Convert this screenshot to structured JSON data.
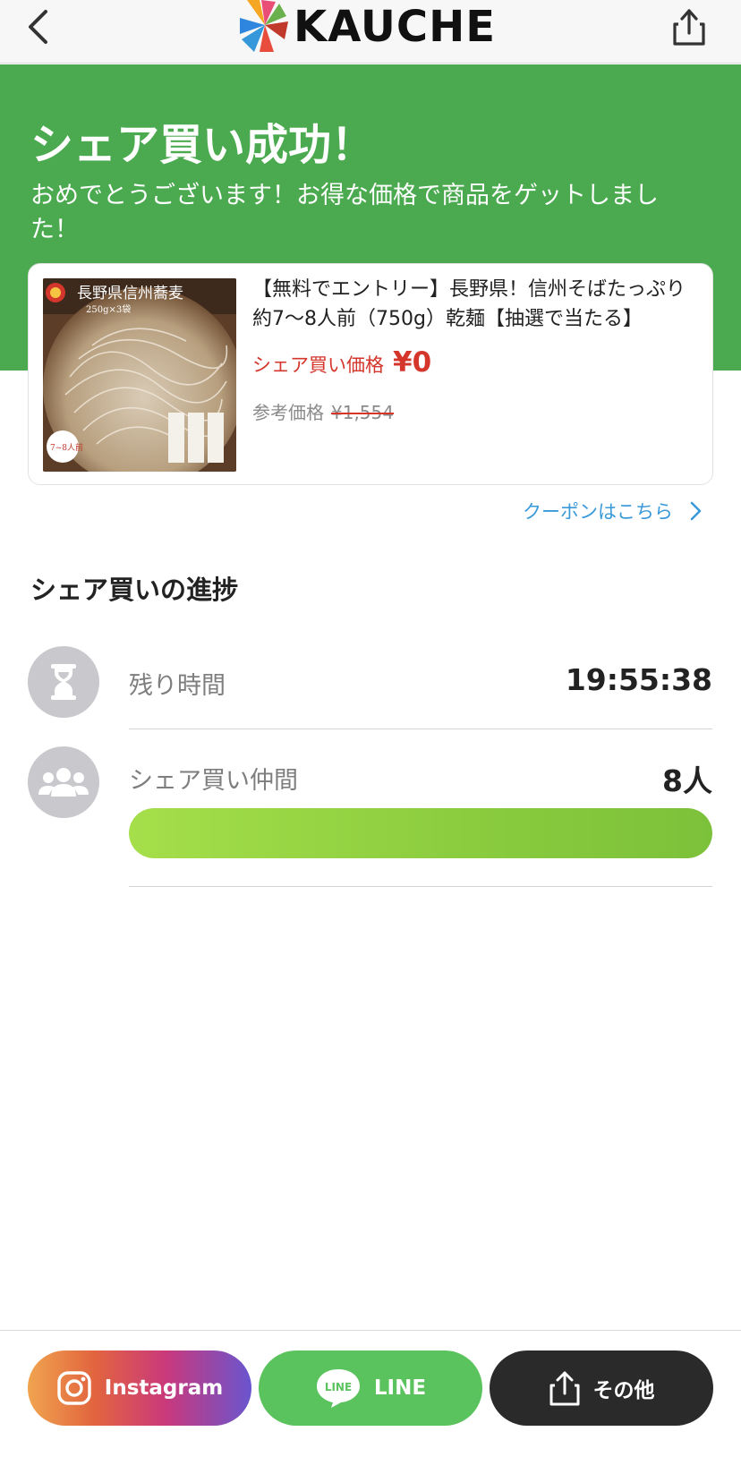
{
  "header": {
    "logo_text": "KAUCHE",
    "back_icon": "chevron-left-icon",
    "share_icon": "share-icon"
  },
  "hero": {
    "title": "シェア買い成功！",
    "subtitle": "おめでとうございます！お得な価格で商品をゲットしました！"
  },
  "product": {
    "title": "【無料でエントリー】長野県！信州そばたっぷり約7〜8人前（750g）乾麺【抽選で当たる】",
    "price_label": "シェア買い価格",
    "price_value": "¥0",
    "ref_label": "参考価格",
    "ref_value": "¥1,554",
    "image_caption": "長野県信州蕎麦",
    "image_sub": "250g×3袋",
    "image_badge": "7~8人前"
  },
  "coupon": {
    "label": "クーポンはこちら"
  },
  "progress": {
    "section_title": "シェア買いの進捗",
    "time_label": "残り時間",
    "time_value": "19:55:38",
    "members_label": "シェア買い仲間",
    "members_value": "8人",
    "progress_fraction": 1.0
  },
  "share_bar": {
    "instagram_label": "Instagram",
    "line_label": "LINE",
    "line_logo_text": "LINE",
    "other_label": "その他"
  },
  "colors": {
    "brand_green": "#4baa4f",
    "price_red": "#d4362b",
    "link_blue": "#3a9ad9",
    "line_green": "#5ac35e"
  }
}
